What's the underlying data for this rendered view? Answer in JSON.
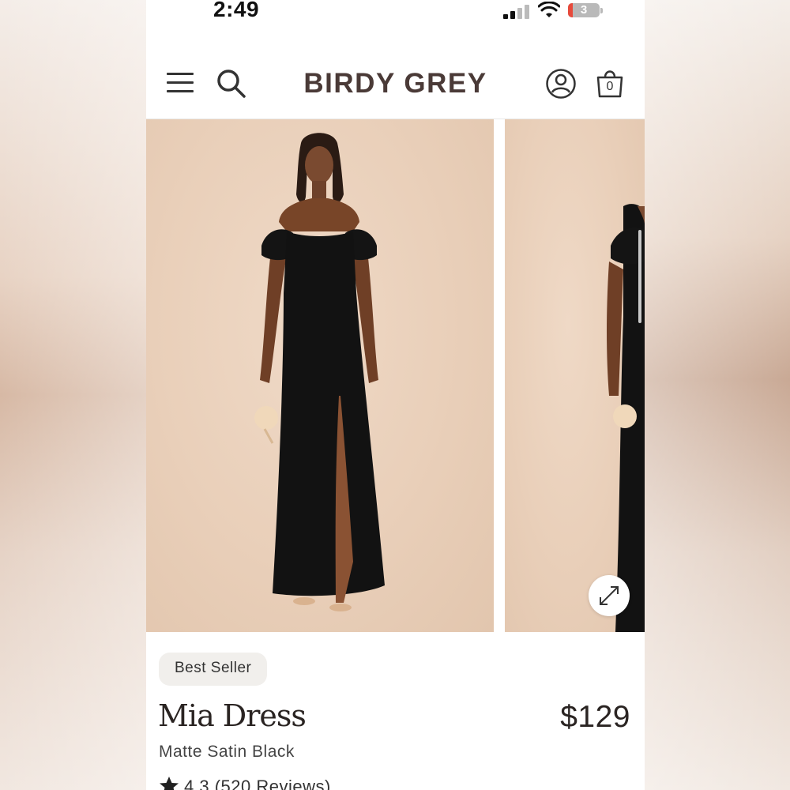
{
  "status_bar": {
    "time": "2:49",
    "battery_level": "3",
    "icons": [
      "signal-icon",
      "wifi-icon",
      "battery-icon"
    ]
  },
  "header": {
    "logo": "BIRDY GREY",
    "cart_count": "0",
    "icons": [
      "menu-icon",
      "search-icon",
      "account-icon",
      "shopping-bag-icon"
    ]
  },
  "gallery": {
    "icons": [
      "expand-icon"
    ]
  },
  "product": {
    "badge": "Best Seller",
    "name": "Mia Dress",
    "price": "$129",
    "variant": "Matte Satin Black",
    "rating": "4.3",
    "reviews": "(520 Reviews)"
  },
  "colors": {
    "brand": "#4a3a37",
    "photo_background": "#e9cfb9",
    "dress": "#111111"
  }
}
